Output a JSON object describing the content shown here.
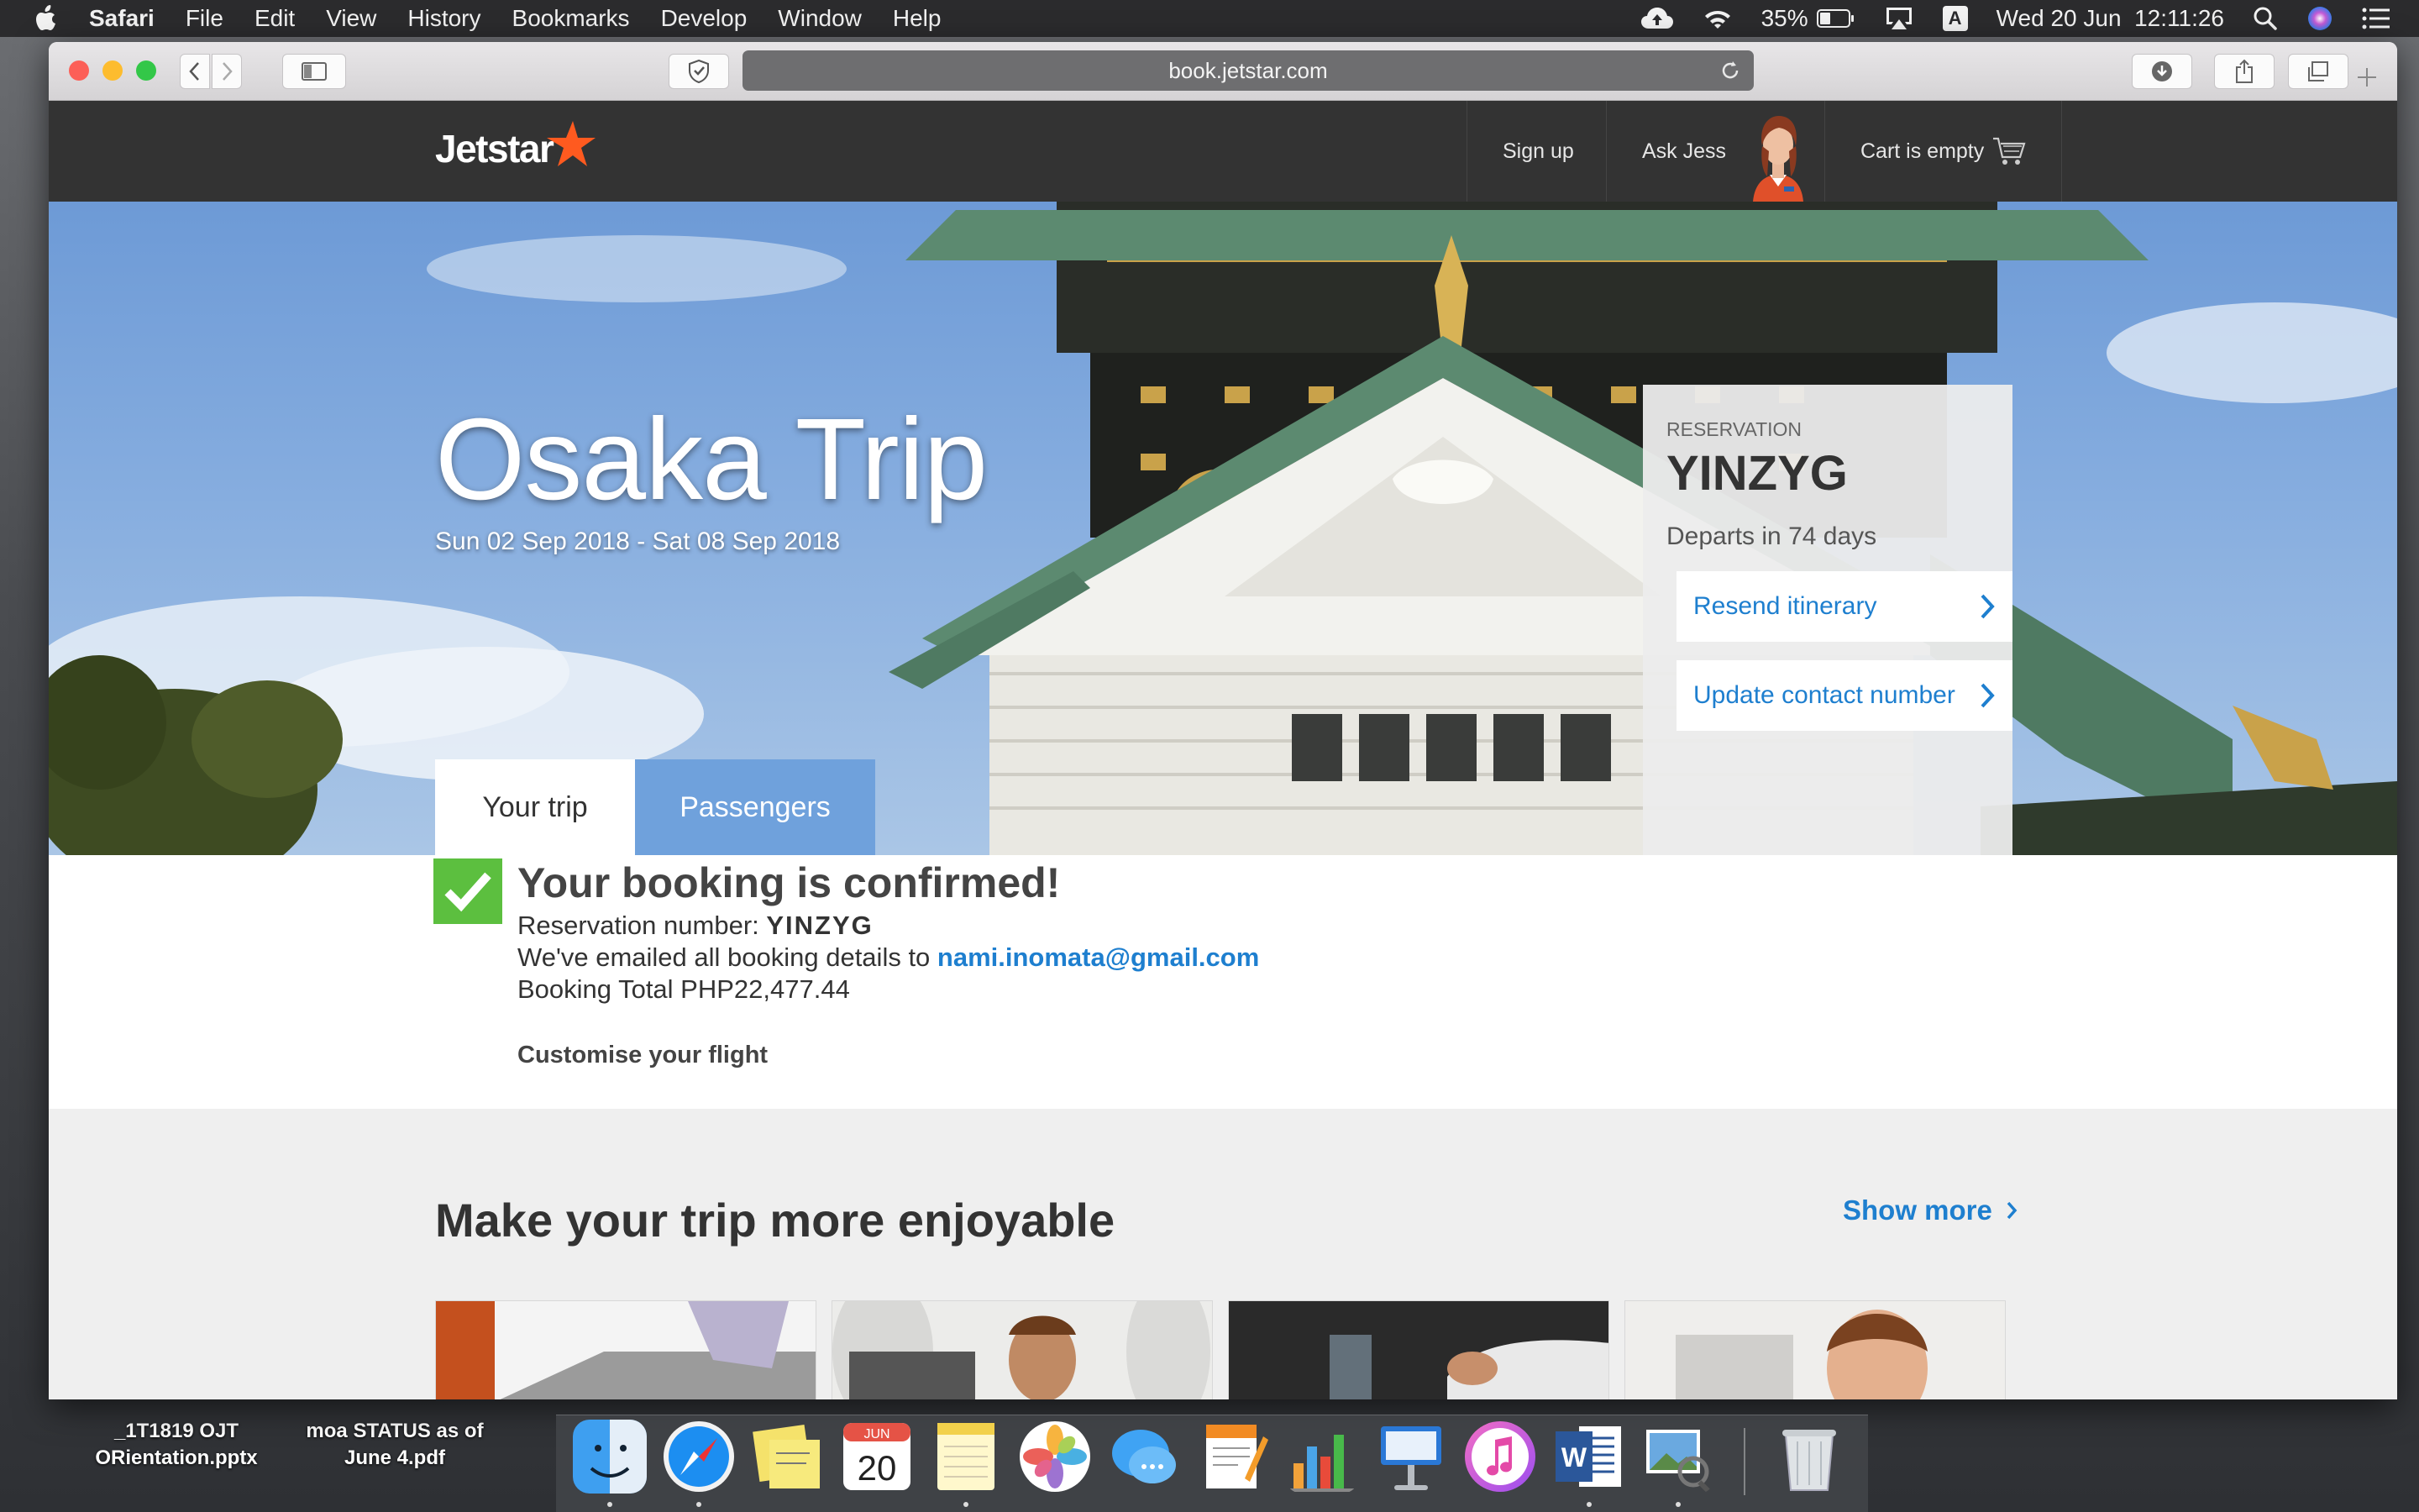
{
  "menubar": {
    "app": "Safari",
    "items": [
      "File",
      "Edit",
      "View",
      "History",
      "Bookmarks",
      "Develop",
      "Window",
      "Help"
    ],
    "battery": "35%",
    "input_source": "A",
    "datetime": "Wed 20 Jun  12:11:26"
  },
  "browser": {
    "url": "book.jetstar.com"
  },
  "jetstar": {
    "logo_text": "Jetstar",
    "nav": {
      "signup": "Sign up",
      "ask_jess": "Ask Jess",
      "cart": "Cart is empty"
    },
    "hero": {
      "title": "Osaka Trip",
      "dates": "Sun 02 Sep 2018 - Sat 08 Sep 2018"
    },
    "reservation_card": {
      "label": "RESERVATION",
      "code": "YINZYG",
      "departs": "Departs in 74 days",
      "resend": "Resend itinerary",
      "update_contact": "Update contact number"
    },
    "tabs": {
      "your_trip": "Your trip",
      "passengers": "Passengers"
    },
    "confirmation": {
      "heading": "Your booking is confirmed!",
      "reservation_label": "Reservation number:",
      "reservation_number": "YINZYG",
      "emailed_text": "We've emailed all booking details to",
      "email": "nami.inomata@gmail.com",
      "total": "Booking Total PHP22,477.44",
      "customise": "Customise your flight"
    },
    "enjoy": {
      "title": "Make your trip more enjoyable",
      "show_more": "Show more"
    }
  },
  "desktop": {
    "file1_line1": "_1T1819 OJT",
    "file1_line2": "ORientation.pptx",
    "file2_line1": "moa STATUS as of",
    "file2_line2": "June 4.pdf"
  },
  "dock": {
    "calendar_month": "JUN",
    "calendar_day": "20",
    "apps": [
      "finder-icon",
      "safari-icon",
      "stickies-icon",
      "calendar-icon",
      "notes-icon",
      "photos-icon",
      "messages-icon",
      "pages-icon",
      "numbers-icon",
      "keynote-icon",
      "itunes-icon",
      "word-icon",
      "preview-icon",
      "trash-icon"
    ]
  },
  "colors": {
    "jetstar_header": "#333333",
    "link_blue": "#1e7fcf",
    "confirm_green": "#5cbf3f",
    "jetstar_orange": "#ff5a1f"
  }
}
